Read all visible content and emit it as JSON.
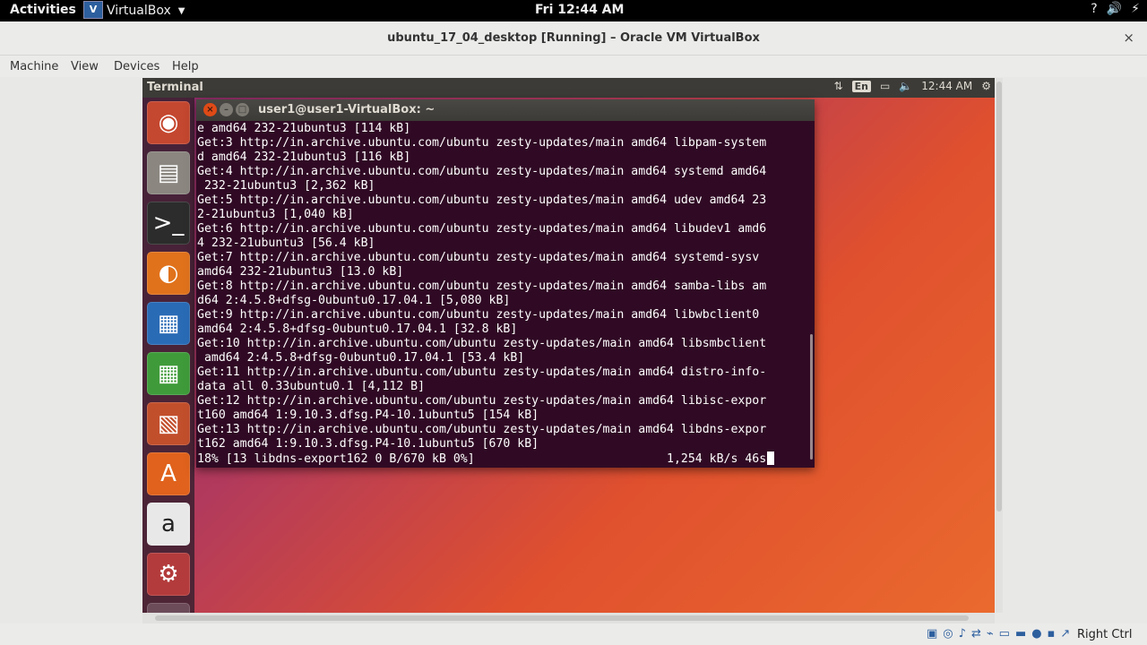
{
  "topbar": {
    "activities": "Activities",
    "app_name": "VirtualBox",
    "clock": "Fri 12:44 AM",
    "tray": [
      "?",
      "🔊",
      "⚡"
    ]
  },
  "vbox": {
    "title": "ubuntu_17_04_desktop [Running] – Oracle VM VirtualBox",
    "close": "×",
    "menu": [
      "Machine",
      "View",
      "Devices",
      "Help"
    ],
    "host_key": "Right Ctrl"
  },
  "guest": {
    "app_name": "Terminal",
    "lang": "En",
    "time": "12:44 AM",
    "launcher": [
      "ubuntu-icon",
      "files-icon",
      "terminal-icon",
      "firefox-icon",
      "writer-icon",
      "calc-icon",
      "impress-icon",
      "software-icon",
      "amazon-icon",
      "settings-icon"
    ]
  },
  "terminal": {
    "title": "user1@user1-VirtualBox: ~",
    "lines": [
      "e amd64 232-21ubuntu3 [114 kB]",
      "Get:3 http://in.archive.ubuntu.com/ubuntu zesty-updates/main amd64 libpam-system",
      "d amd64 232-21ubuntu3 [116 kB]",
      "Get:4 http://in.archive.ubuntu.com/ubuntu zesty-updates/main amd64 systemd amd64",
      " 232-21ubuntu3 [2,362 kB]",
      "Get:5 http://in.archive.ubuntu.com/ubuntu zesty-updates/main amd64 udev amd64 23",
      "2-21ubuntu3 [1,040 kB]",
      "Get:6 http://in.archive.ubuntu.com/ubuntu zesty-updates/main amd64 libudev1 amd6",
      "4 232-21ubuntu3 [56.4 kB]",
      "Get:7 http://in.archive.ubuntu.com/ubuntu zesty-updates/main amd64 systemd-sysv",
      "amd64 232-21ubuntu3 [13.0 kB]",
      "Get:8 http://in.archive.ubuntu.com/ubuntu zesty-updates/main amd64 samba-libs am",
      "d64 2:4.5.8+dfsg-0ubuntu0.17.04.1 [5,080 kB]",
      "Get:9 http://in.archive.ubuntu.com/ubuntu zesty-updates/main amd64 libwbclient0",
      "amd64 2:4.5.8+dfsg-0ubuntu0.17.04.1 [32.8 kB]",
      "Get:10 http://in.archive.ubuntu.com/ubuntu zesty-updates/main amd64 libsmbclient",
      " amd64 2:4.5.8+dfsg-0ubuntu0.17.04.1 [53.4 kB]",
      "Get:11 http://in.archive.ubuntu.com/ubuntu zesty-updates/main amd64 distro-info-",
      "data all 0.33ubuntu0.1 [4,112 B]",
      "Get:12 http://in.archive.ubuntu.com/ubuntu zesty-updates/main amd64 libisc-expor",
      "t160 amd64 1:9.10.3.dfsg.P4-10.1ubuntu5 [154 kB]",
      "Get:13 http://in.archive.ubuntu.com/ubuntu zesty-updates/main amd64 libdns-expor",
      "t162 amd64 1:9.10.3.dfsg.P4-10.1ubuntu5 [670 kB]",
      "18% [13 libdns-export162 0 B/670 kB 0%]                           1,254 kB/s 46s"
    ]
  }
}
